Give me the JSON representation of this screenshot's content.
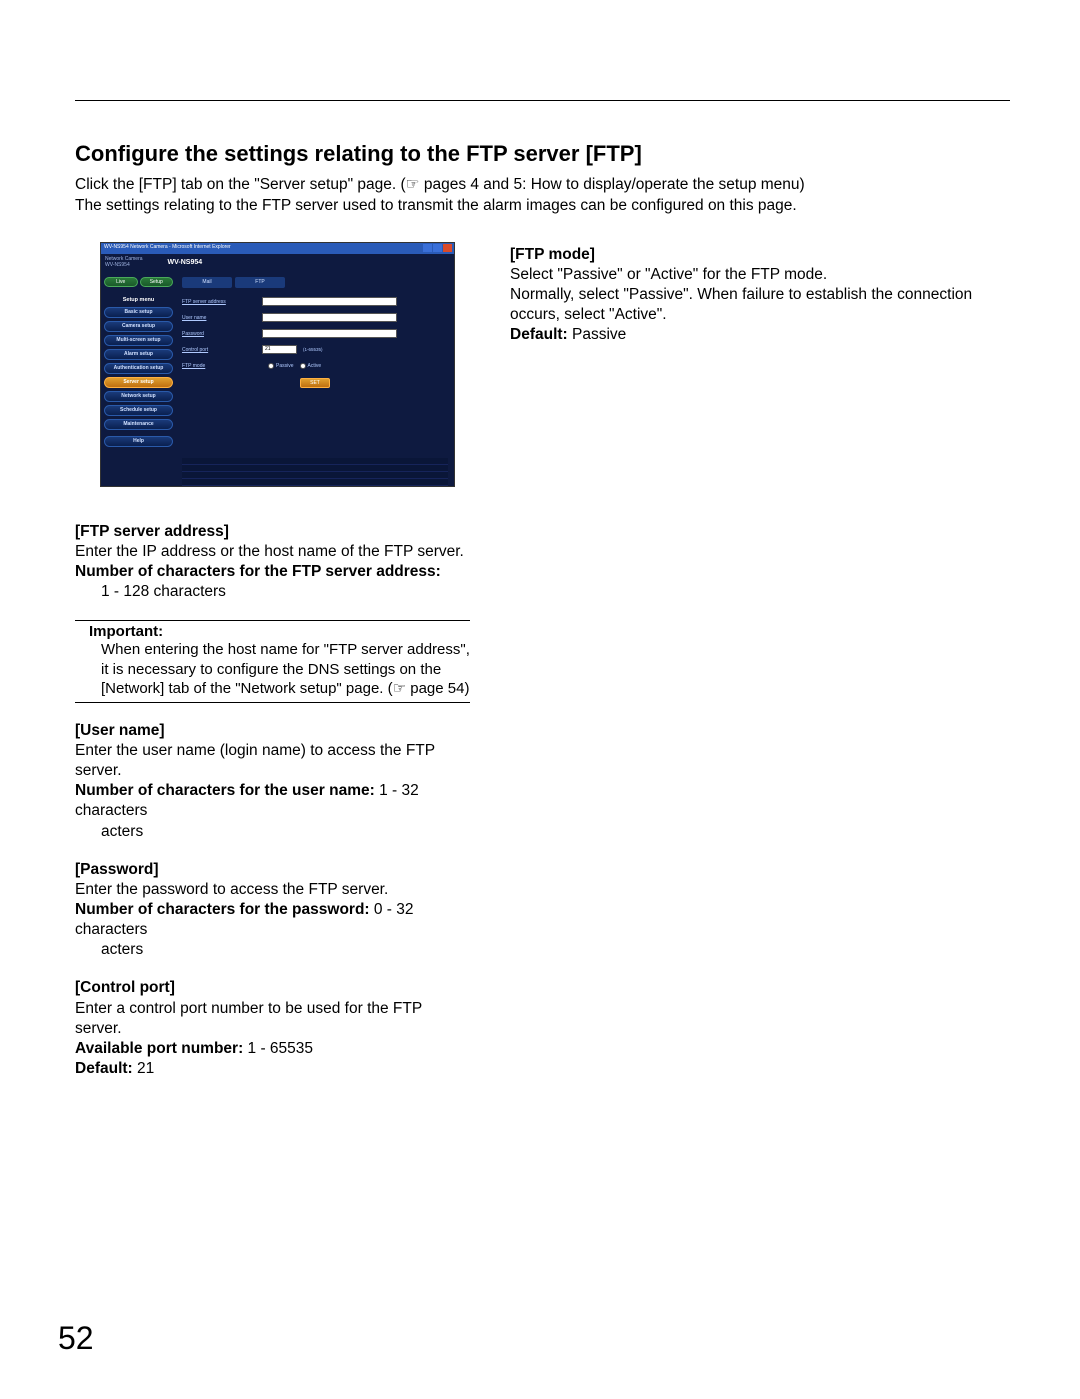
{
  "heading": "Configure the settings relating to the FTP server [FTP]",
  "intro_line1": "Click the [FTP] tab on the \"Server setup\" page. (☞ pages 4 and 5: How to display/operate the setup menu)",
  "intro_line2": "The settings relating to the FTP server used to transmit the alarm images can be configured on this page.",
  "screenshot": {
    "window_title": "WV-NS954 Network Camera - Microsoft Internet Explorer",
    "brand_small": "Network Camera",
    "brand_model_left": "WV-NS954",
    "brand_model": "WV-NS954",
    "live_btn": "Live",
    "setup_btn": "Setup",
    "setup_menu_label": "Setup menu",
    "menu": [
      "Basic setup",
      "Camera setup",
      "Multi-screen setup",
      "Alarm setup",
      "Authentication setup",
      "Server setup",
      "Network setup",
      "Schedule setup",
      "Maintenance",
      "Help"
    ],
    "active_menu_index": 5,
    "tabs": [
      "Mail",
      "FTP"
    ],
    "form": {
      "ftp_server_address": "FTP server address",
      "user_name": "User name",
      "password": "Password",
      "control_port": "Control port",
      "control_port_value": "21",
      "control_port_note": "(1-65535)",
      "ftp_mode": "FTP mode",
      "passive": "Passive",
      "active": "Active",
      "set": "SET"
    }
  },
  "left": {
    "ftp_addr_hdr": "[FTP server address]",
    "ftp_addr_body": "Enter the IP address or the host name of the FTP server.",
    "ftp_addr_chars_label": "Number of characters for the FTP server address:",
    "ftp_addr_chars_val": "1 - 128 characters",
    "important_hdr": "Important:",
    "important_body": "When entering the host name for \"FTP server address\", it is necessary to configure the DNS settings on the [Network] tab of the \"Network setup\" page. (☞ page 54)",
    "user_name_hdr": "[User name]",
    "user_name_body": "Enter the user name (login name) to access the FTP server.",
    "user_name_chars_label": "Number of characters for the user name:",
    "user_name_chars_val": " 1 - 32 characters",
    "password_hdr": "[Password]",
    "password_body": "Enter the password to access the FTP server.",
    "password_chars_label": "Number of characters for the password:",
    "password_chars_val": " 0 - 32 characters",
    "control_port_hdr": "[Control port]",
    "control_port_body": "Enter a control port number to be used for the FTP server.",
    "control_port_avail_label": "Available port number:",
    "control_port_avail_val": " 1 - 65535",
    "control_port_default_label": "Default:",
    "control_port_default_val": " 21"
  },
  "right": {
    "ftp_mode_hdr": "[FTP mode]",
    "ftp_mode_body1": "Select \"Passive\" or \"Active\" for the FTP mode.",
    "ftp_mode_body2": "Normally, select \"Passive\". When failure to establish the connection occurs, select \"Active\".",
    "ftp_mode_default_label": "Default:",
    "ftp_mode_default_val": " Passive"
  },
  "page_number": "52"
}
